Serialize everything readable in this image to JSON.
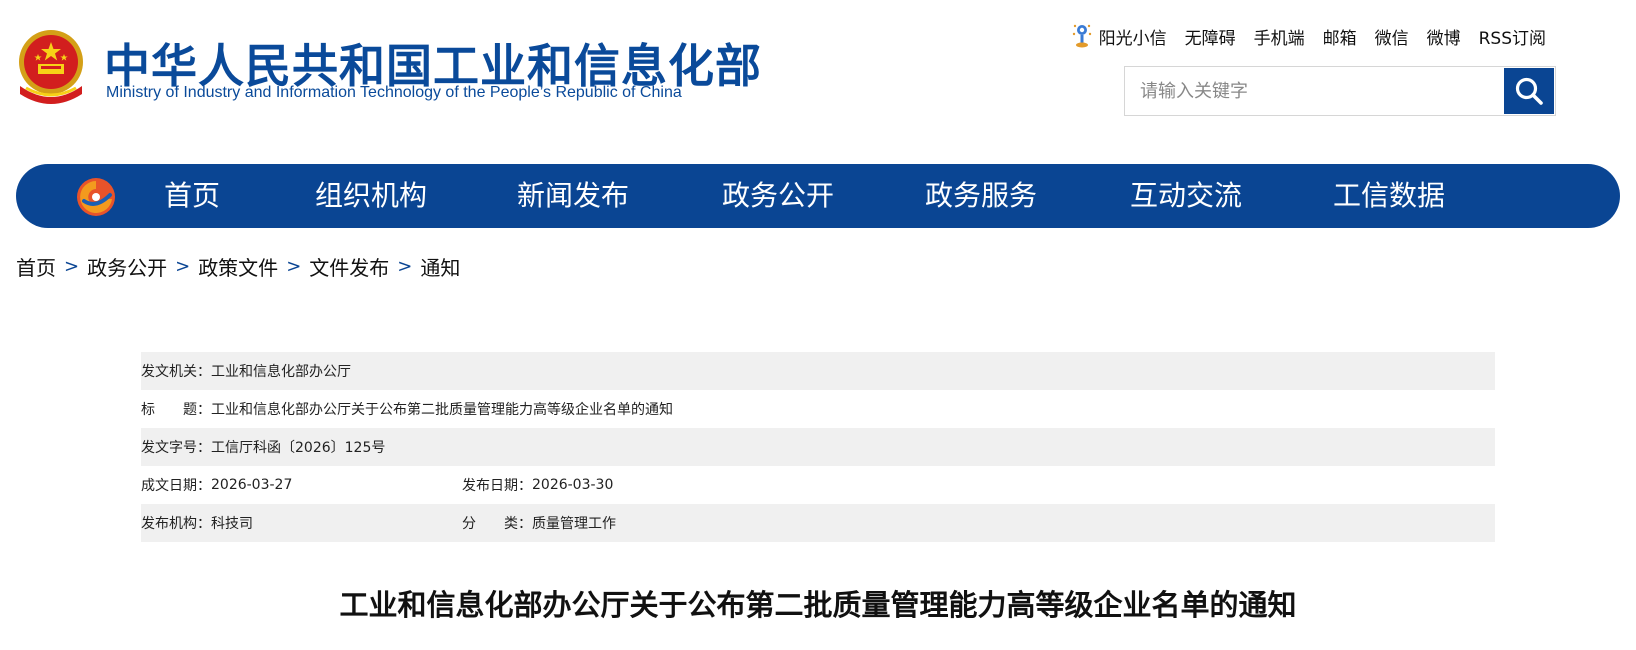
{
  "header": {
    "org_name_cn": "中华人民共和国工业和信息化部",
    "org_name_en": "Ministry of Industry and Information Technology of the People’s Republic of China",
    "emblem_icon": "national-emblem-icon",
    "top_links": [
      "阳光小信",
      "无障碍",
      "手机端",
      "邮箱",
      "微信",
      "微博",
      "RSS订阅"
    ],
    "search": {
      "placeholder": "请输入关键字",
      "value": "",
      "button_icon": "search-icon"
    }
  },
  "nav": {
    "logo_icon": "miit-logo-icon",
    "items": [
      "首页",
      "组织机构",
      "新闻发布",
      "政务公开",
      "政务服务",
      "互动交流",
      "工信数据"
    ]
  },
  "breadcrumb": {
    "items": [
      "首页",
      "政务公开",
      "政策文件",
      "文件发布",
      "通知"
    ],
    "separator": ">"
  },
  "document_info": {
    "issuer_label": "发文机关：",
    "issuer": "工业和信息化部办公厅",
    "title_label": "标　　题：",
    "title": "工业和信息化部办公厅关于公布第二批质量管理能力高等级企业名单的通知",
    "doc_number_label": "发文字号：",
    "doc_number": "工信厅科函〔2026〕125号",
    "written_date_label": "成文日期：",
    "written_date": "2026-03-27",
    "publish_date_label": "发布日期：",
    "publish_date": "2026-03-30",
    "department_label": "发布机构：",
    "department": "科技司",
    "category_label": "分　　类：",
    "category": "质量管理工作"
  },
  "article": {
    "title": "工业和信息化部办公厅关于公布第二批质量管理能力高等级企业名单的通知"
  },
  "colors": {
    "brand_blue": "#0a4593",
    "title_blue": "#0a4a9a",
    "row_shade": "#f0f0f0"
  }
}
